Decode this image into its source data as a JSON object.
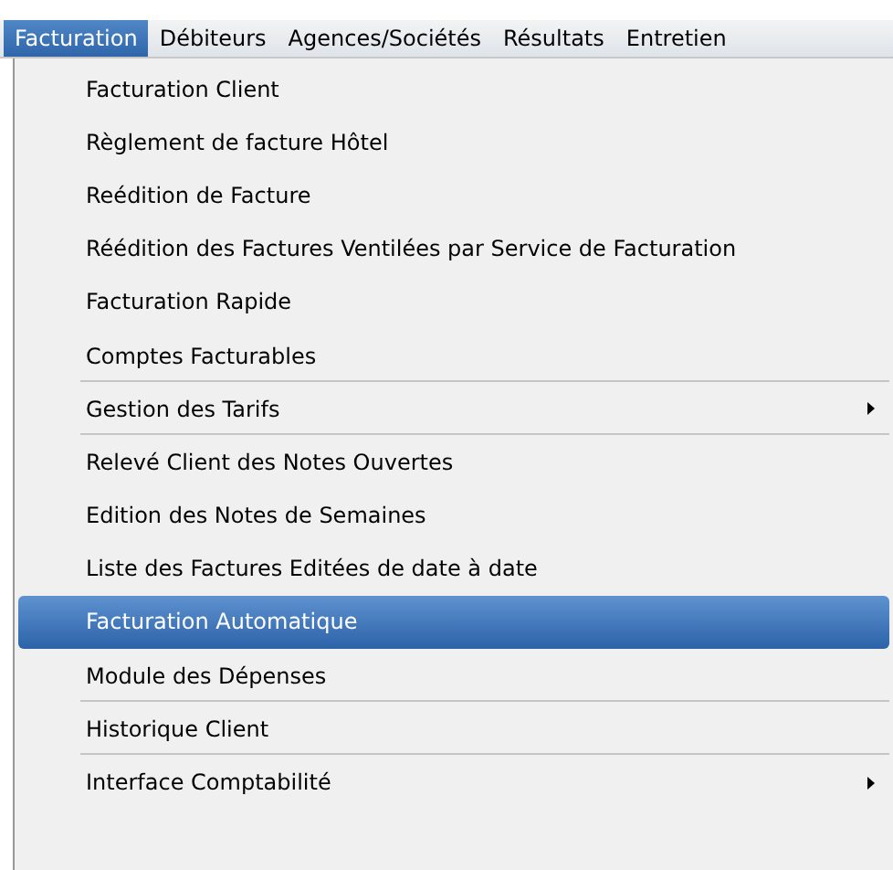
{
  "menu_bar": [
    {
      "label": "Facturation",
      "selected": true
    },
    {
      "label": "Débiteurs",
      "selected": false
    },
    {
      "label": "Agences/Sociétés",
      "selected": false
    },
    {
      "label": "Résultats",
      "selected": false
    },
    {
      "label": "Entretien",
      "selected": false
    }
  ],
  "menu_items": [
    {
      "label": "Facturation Client",
      "selected": false,
      "submenu": false,
      "separator_after": false
    },
    {
      "label": "Règlement de facture Hôtel",
      "selected": false,
      "submenu": false,
      "separator_after": false
    },
    {
      "label": "Reédition de Facture",
      "selected": false,
      "submenu": false,
      "separator_after": false
    },
    {
      "label": "Réédition des Factures Ventilées par Service de Facturation",
      "selected": false,
      "submenu": false,
      "separator_after": false
    },
    {
      "label": "Facturation Rapide",
      "selected": false,
      "submenu": false,
      "separator_after": false
    },
    {
      "label": "Comptes Facturables",
      "selected": false,
      "submenu": false,
      "separator_after": true
    },
    {
      "label": "Gestion des Tarifs",
      "selected": false,
      "submenu": true,
      "separator_after": true
    },
    {
      "label": "Relevé Client des Notes Ouvertes",
      "selected": false,
      "submenu": false,
      "separator_after": false
    },
    {
      "label": "Edition des Notes de Semaines",
      "selected": false,
      "submenu": false,
      "separator_after": false
    },
    {
      "label": "Liste des Factures Editées de date à date",
      "selected": false,
      "submenu": false,
      "separator_after": false
    },
    {
      "label": "Facturation Automatique",
      "selected": true,
      "submenu": false,
      "separator_after": false
    },
    {
      "label": "Module des Dépenses",
      "selected": false,
      "submenu": false,
      "separator_after": true
    },
    {
      "label": "Historique Client",
      "selected": false,
      "submenu": false,
      "separator_after": true
    },
    {
      "label": "Interface Comptabilité",
      "selected": false,
      "submenu": true,
      "separator_after": false
    }
  ]
}
